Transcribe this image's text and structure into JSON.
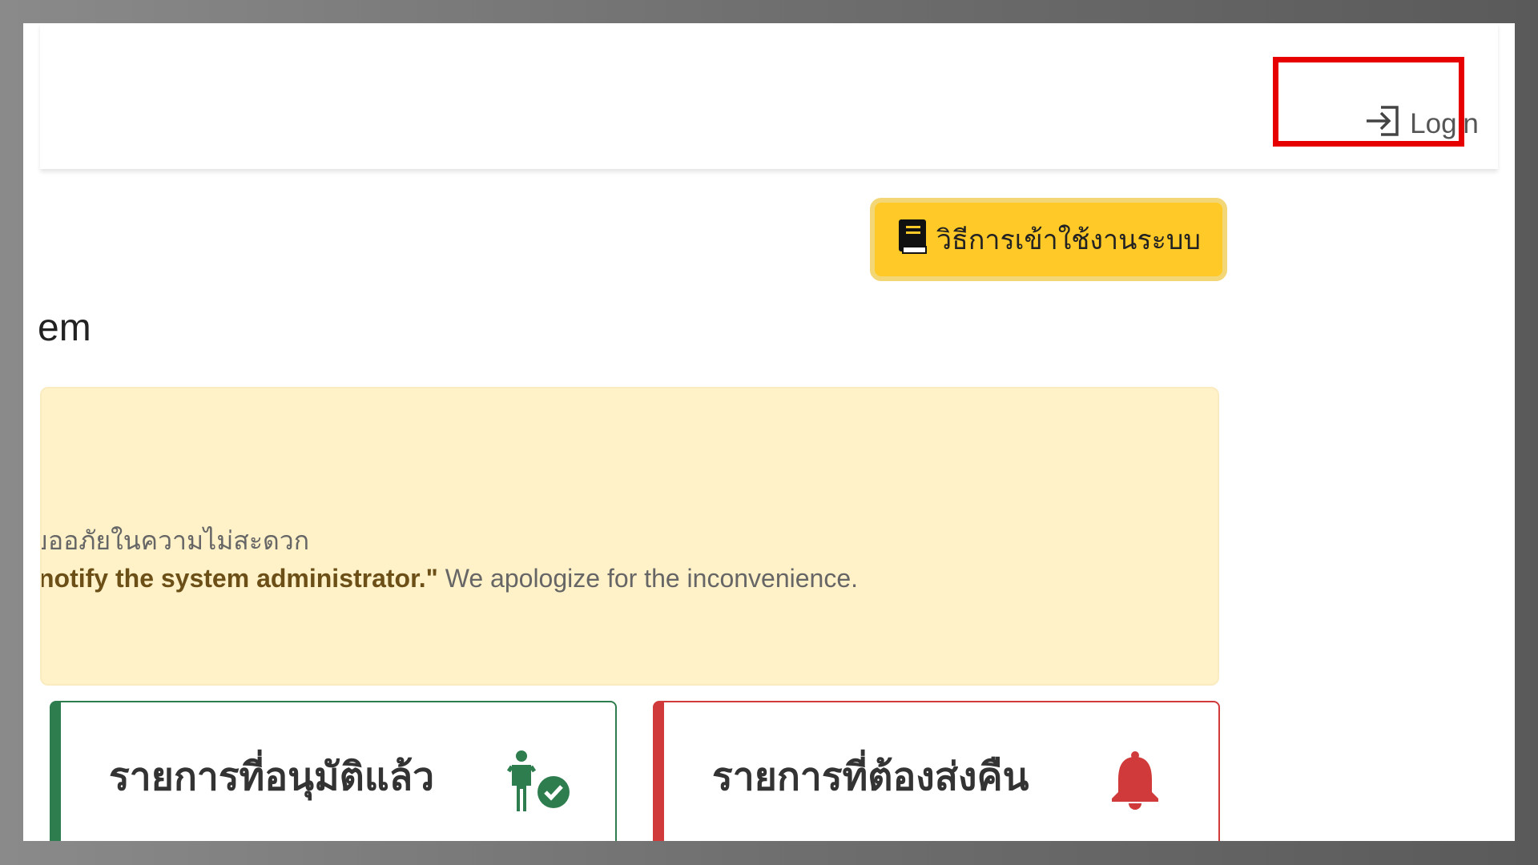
{
  "header": {
    "login_label": "Login"
  },
  "toolbar": {
    "manual_label": "วิธีการเข้าใช้งานระบบ"
  },
  "page": {
    "title_fragment": "em"
  },
  "notice": {
    "thai_text": "ขออภัยในความไม่สะดวก",
    "en_bold": "notify the system administrator.\"",
    "en_text": " We apologize for the inconvenience."
  },
  "cards": [
    {
      "title": "รายการที่อนุมัติแล้ว",
      "icon": "person-check-icon",
      "accent": "#2e7d4f"
    },
    {
      "title": "รายการที่ต้องส่งคืน",
      "icon": "bell-icon",
      "accent": "#d03a3a"
    }
  ],
  "colors": {
    "highlight": "#e60000",
    "manual_button": "#ffca28",
    "notice_bg": "#fff1c8"
  }
}
